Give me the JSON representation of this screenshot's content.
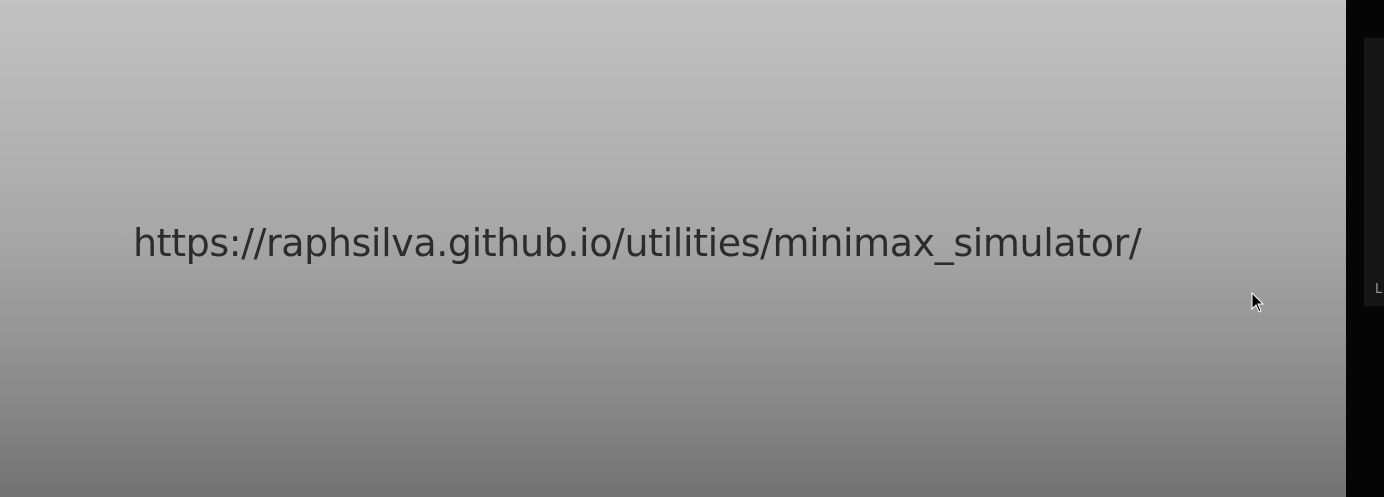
{
  "slide": {
    "url_text": "https://raphsilva.github.io/utilities/minimax_simulator/"
  },
  "side_panel": {
    "label": "L"
  },
  "cursor": {
    "icon": "mouse-pointer-icon"
  },
  "colors": {
    "slide_gradient_top": "#c2c2c2",
    "slide_gradient_bottom": "#727272",
    "text": "#2c2c2c",
    "panel": "#050505"
  }
}
